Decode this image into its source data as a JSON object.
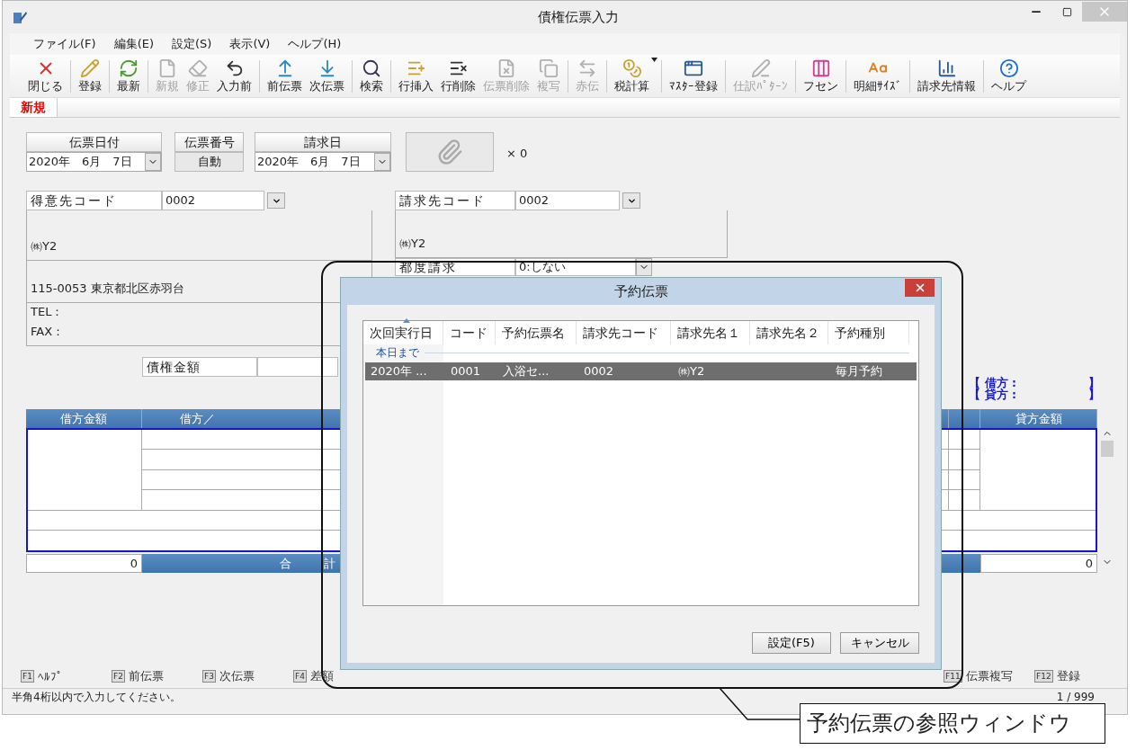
{
  "window": {
    "title": "債権伝票入力"
  },
  "menu": [
    "ファイル(F)",
    "編集(E)",
    "設定(S)",
    "表示(V)",
    "ヘルプ(H)"
  ],
  "toolbar": [
    {
      "label": "閉じる",
      "disabled": false,
      "separator_before": false
    },
    {
      "label": "登録",
      "disabled": false,
      "separator_before": true
    },
    {
      "label": "最新",
      "disabled": false,
      "separator_before": true
    },
    {
      "label": "新規",
      "disabled": true,
      "separator_before": true
    },
    {
      "label": "修正",
      "disabled": true,
      "separator_before": false
    },
    {
      "label": "入力前",
      "disabled": false,
      "separator_before": false
    },
    {
      "label": "前伝票",
      "disabled": false,
      "separator_before": true
    },
    {
      "label": "次伝票",
      "disabled": false,
      "separator_before": false
    },
    {
      "label": "検索",
      "disabled": false,
      "separator_before": true
    },
    {
      "label": "行挿入",
      "disabled": false,
      "separator_before": true
    },
    {
      "label": "行削除",
      "disabled": false,
      "separator_before": false
    },
    {
      "label": "伝票削除",
      "disabled": true,
      "separator_before": false
    },
    {
      "label": "複写",
      "disabled": true,
      "separator_before": false
    },
    {
      "label": "赤伝",
      "disabled": true,
      "separator_before": true
    },
    {
      "label": "税計算",
      "disabled": false,
      "separator_before": true,
      "dropdown": true
    },
    {
      "label": "ﾏｽﾀｰ登録",
      "disabled": false,
      "separator_before": true
    },
    {
      "label": "仕訳ﾊﾟﾀｰﾝ",
      "disabled": true,
      "separator_before": true
    },
    {
      "label": "フセン",
      "disabled": false,
      "separator_before": true
    },
    {
      "label": "明細ｻｲｽﾞ",
      "disabled": false,
      "separator_before": true
    },
    {
      "label": "請求先情報",
      "disabled": false,
      "separator_before": true
    },
    {
      "label": "ヘルプ",
      "disabled": false,
      "separator_before": true
    }
  ],
  "tabs": [
    {
      "label": "新規",
      "selected": true
    }
  ],
  "header": {
    "voucher_date": {
      "label": "伝票日付",
      "value": "2020年　6月　7日"
    },
    "voucher_number": {
      "label": "伝票番号",
      "value": "自動"
    },
    "billing_date": {
      "label": "請求日",
      "value": "2020年　6月　7日"
    },
    "attachment_count": "× 0"
  },
  "customer": {
    "label": "得意先コード",
    "code": "0002",
    "name": "㈱Y2",
    "address": "115-0053 東京都北区赤羽台",
    "tel": "TEL：",
    "fax": "FAX："
  },
  "billing": {
    "label": "請求先コード",
    "code": "0002",
    "name": "㈱Y2",
    "per_bill_label": "都度請求",
    "per_bill_value": "0:しない"
  },
  "amount": {
    "label": "債権金額"
  },
  "balance": {
    "debit": "【 借方 :",
    "debit_end": "】",
    "credit": "【 貸方 :",
    "credit_end": "】"
  },
  "table": {
    "columns": [
      "借方金額",
      "借方／",
      "貸方金額"
    ],
    "total_debit": "0",
    "total_label_1": "合",
    "total_label_2": "計",
    "total_credit": "0"
  },
  "function_keys_left": [
    {
      "key": "F1",
      "label": "ﾍﾙﾌﾟ"
    },
    {
      "key": "F2",
      "label": "前伝票"
    },
    {
      "key": "F3",
      "label": "次伝票"
    },
    {
      "key": "F4",
      "label": "差額"
    }
  ],
  "function_keys_right": [
    {
      "key": "F11",
      "label": "伝票複写"
    },
    {
      "key": "F12",
      "label": "登録"
    }
  ],
  "status_bar": {
    "message": "半角4桁以内で入力してください。",
    "page": "1 / 999"
  },
  "dialog": {
    "title": "予約伝票",
    "columns": [
      "次回実行日",
      "コード",
      "予約伝票名",
      "請求先コード",
      "請求先名１",
      "請求先名２",
      "予約種別"
    ],
    "group": "本日まで",
    "rows": [
      {
        "cells": [
          "2020年 ...",
          "0001",
          "入浴セ...",
          "0002",
          "㈱Y2",
          "",
          "毎月予約"
        ],
        "selected": true
      }
    ],
    "buttons": [
      "設定(F5)",
      "キャンセル"
    ]
  },
  "callout": {
    "label": "予約伝票の参照ウィンドウ"
  }
}
